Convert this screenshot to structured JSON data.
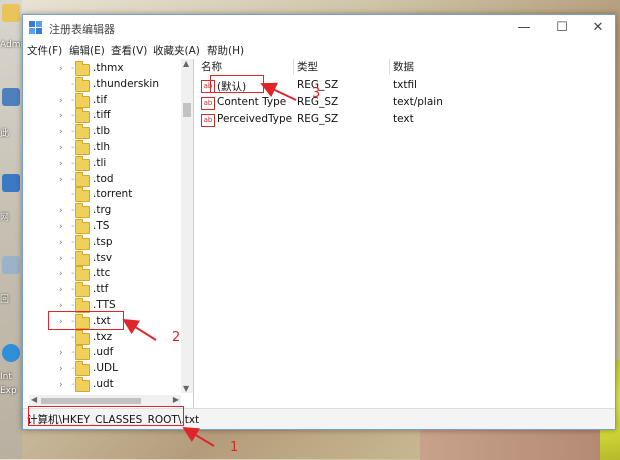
{
  "window": {
    "title": "注册表编辑器",
    "controls": [
      "—",
      "☐",
      "✕"
    ]
  },
  "menu": [
    "文件(F)",
    "编辑(E)",
    "查看(V)",
    "收藏夹(A)",
    "帮助(H)"
  ],
  "desktop": {
    "labels": [
      "Admi",
      "此",
      "网",
      "回",
      "Int",
      "Exp"
    ]
  },
  "tree": {
    "items": [
      {
        "label": ".thmx",
        "expander": true
      },
      {
        "label": ".thunderskin",
        "expander": false
      },
      {
        "label": ".tif",
        "expander": true
      },
      {
        "label": ".tiff",
        "expander": true
      },
      {
        "label": ".tlb",
        "expander": true
      },
      {
        "label": ".tlh",
        "expander": true
      },
      {
        "label": ".tli",
        "expander": true
      },
      {
        "label": ".tod",
        "expander": true
      },
      {
        "label": ".torrent",
        "expander": false
      },
      {
        "label": ".trg",
        "expander": true
      },
      {
        "label": ".TS",
        "expander": true
      },
      {
        "label": ".tsp",
        "expander": true
      },
      {
        "label": ".tsv",
        "expander": true
      },
      {
        "label": ".ttc",
        "expander": true
      },
      {
        "label": ".ttf",
        "expander": true
      },
      {
        "label": ".TTS",
        "expander": true
      },
      {
        "label": ".txt",
        "expander": true
      },
      {
        "label": ".txz",
        "expander": false
      },
      {
        "label": ".udf",
        "expander": true
      },
      {
        "label": ".UDL",
        "expander": true
      },
      {
        "label": ".udt",
        "expander": true
      }
    ]
  },
  "list": {
    "columns": {
      "name": "名称",
      "type": "类型",
      "data": "数据"
    },
    "rows": [
      {
        "icon": "ab",
        "name": "(默认)",
        "type": "REG_SZ",
        "data": "txtfil"
      },
      {
        "icon": "ab",
        "name": "Content Type",
        "type": "REG_SZ",
        "data": "text/plain"
      },
      {
        "icon": "ab",
        "name": "PerceivedType",
        "type": "REG_SZ",
        "data": "text"
      }
    ]
  },
  "status": {
    "path": "计算机\\HKEY_CLASSES_ROOT\\.txt"
  },
  "annotations": {
    "labels": [
      "1",
      "2",
      "3"
    ],
    "color": "#e0252a"
  }
}
